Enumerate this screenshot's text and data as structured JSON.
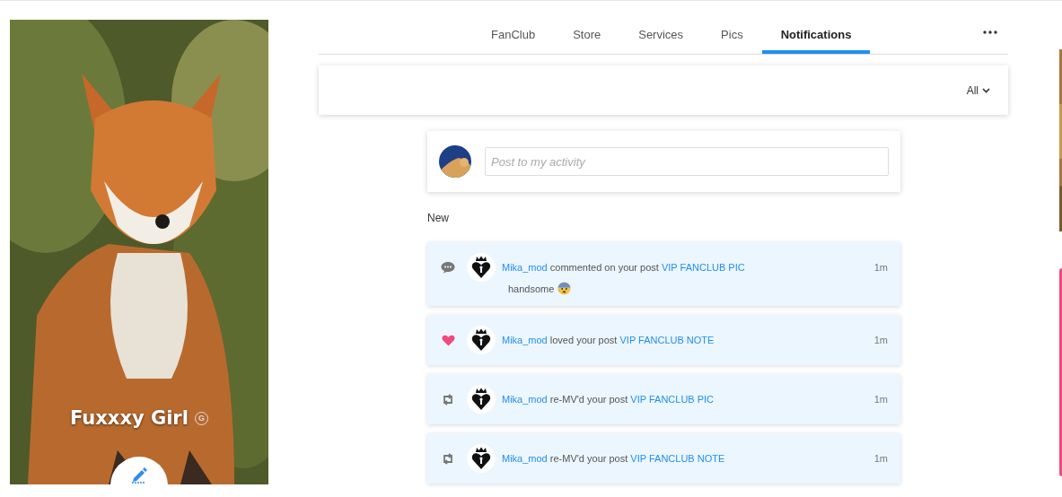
{
  "profile": {
    "name": "Fuxxxy Girl",
    "badge": "G"
  },
  "tabs": [
    {
      "label": "FanClub",
      "selected": false
    },
    {
      "label": "Store",
      "selected": false
    },
    {
      "label": "Services",
      "selected": false
    },
    {
      "label": "Pics",
      "selected": false
    },
    {
      "label": "Notifications",
      "selected": true
    }
  ],
  "filter": {
    "value": "All"
  },
  "composer": {
    "placeholder": "Post to my activity"
  },
  "section_title": "New",
  "notifications": [
    {
      "kind": "comment",
      "user": "Mika_mod",
      "action": "commented on your post",
      "post": "VIP FANCLUB PIC",
      "time": "1m",
      "comment": "handsome"
    },
    {
      "kind": "love",
      "user": "Mika_mod",
      "action": "loved your post",
      "post": "VIP FANCLUB NOTE",
      "time": "1m"
    },
    {
      "kind": "remv",
      "user": "Mika_mod",
      "action": "re-MV'd your post",
      "post": "VIP FANCLUB PIC",
      "time": "1m"
    },
    {
      "kind": "remv",
      "user": "Mika_mod",
      "action": "re-MV'd your post",
      "post": "VIP FANCLUB NOTE",
      "time": "1m"
    }
  ]
}
